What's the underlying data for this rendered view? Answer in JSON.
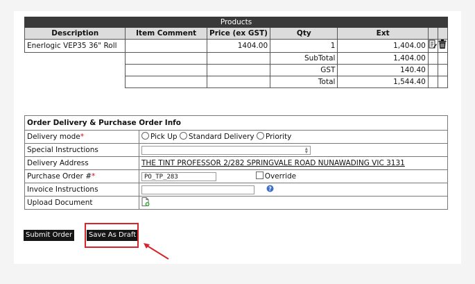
{
  "products": {
    "banner": "Products",
    "headers": [
      "Description",
      "Item Comment",
      "Price (ex GST)",
      "Qty",
      "Ext"
    ],
    "item": {
      "description": "Enerlogic VEP35 36\" Roll",
      "comment": "",
      "price": "1404.00",
      "qty": "1",
      "ext": "1,404.00"
    },
    "totals": {
      "subtotal_label": "SubTotal",
      "subtotal": "1,404.00",
      "gst_label": "GST",
      "gst": "140.40",
      "total_label": "Total",
      "total": "1,544.40"
    },
    "icons": {
      "edit": "edit-icon",
      "delete": "trash-icon"
    }
  },
  "order": {
    "title": "Order Delivery & Purchase Order Info",
    "delivery_mode": {
      "label": "Delivery mode",
      "required_mark": "*",
      "options": [
        "Pick Up",
        "Standard Delivery",
        "Priority"
      ]
    },
    "special_instructions": {
      "label": "Special Instructions",
      "value": ""
    },
    "delivery_address": {
      "label": "Delivery Address",
      "value": "THE TINT PROFESSOR 2/282 SPRINGVALE ROAD NUNAWADING VIC 3131"
    },
    "purchase_order": {
      "label": "Purchase Order #",
      "required_mark": "*",
      "value": "PO_TP_283",
      "override_label": "Override"
    },
    "invoice_instructions": {
      "label": "Invoice Instructions",
      "value": "",
      "help_icon": "help-icon"
    },
    "upload_document": {
      "label": "Upload Document",
      "icon": "add-file-icon"
    }
  },
  "actions": {
    "submit_label": "Submit Order",
    "draft_label": "Save As Draft"
  },
  "colors": {
    "banner": "#3a3a3a",
    "header": "#dcdcdc",
    "required": "#d01010",
    "highlight": "#d8232a"
  }
}
